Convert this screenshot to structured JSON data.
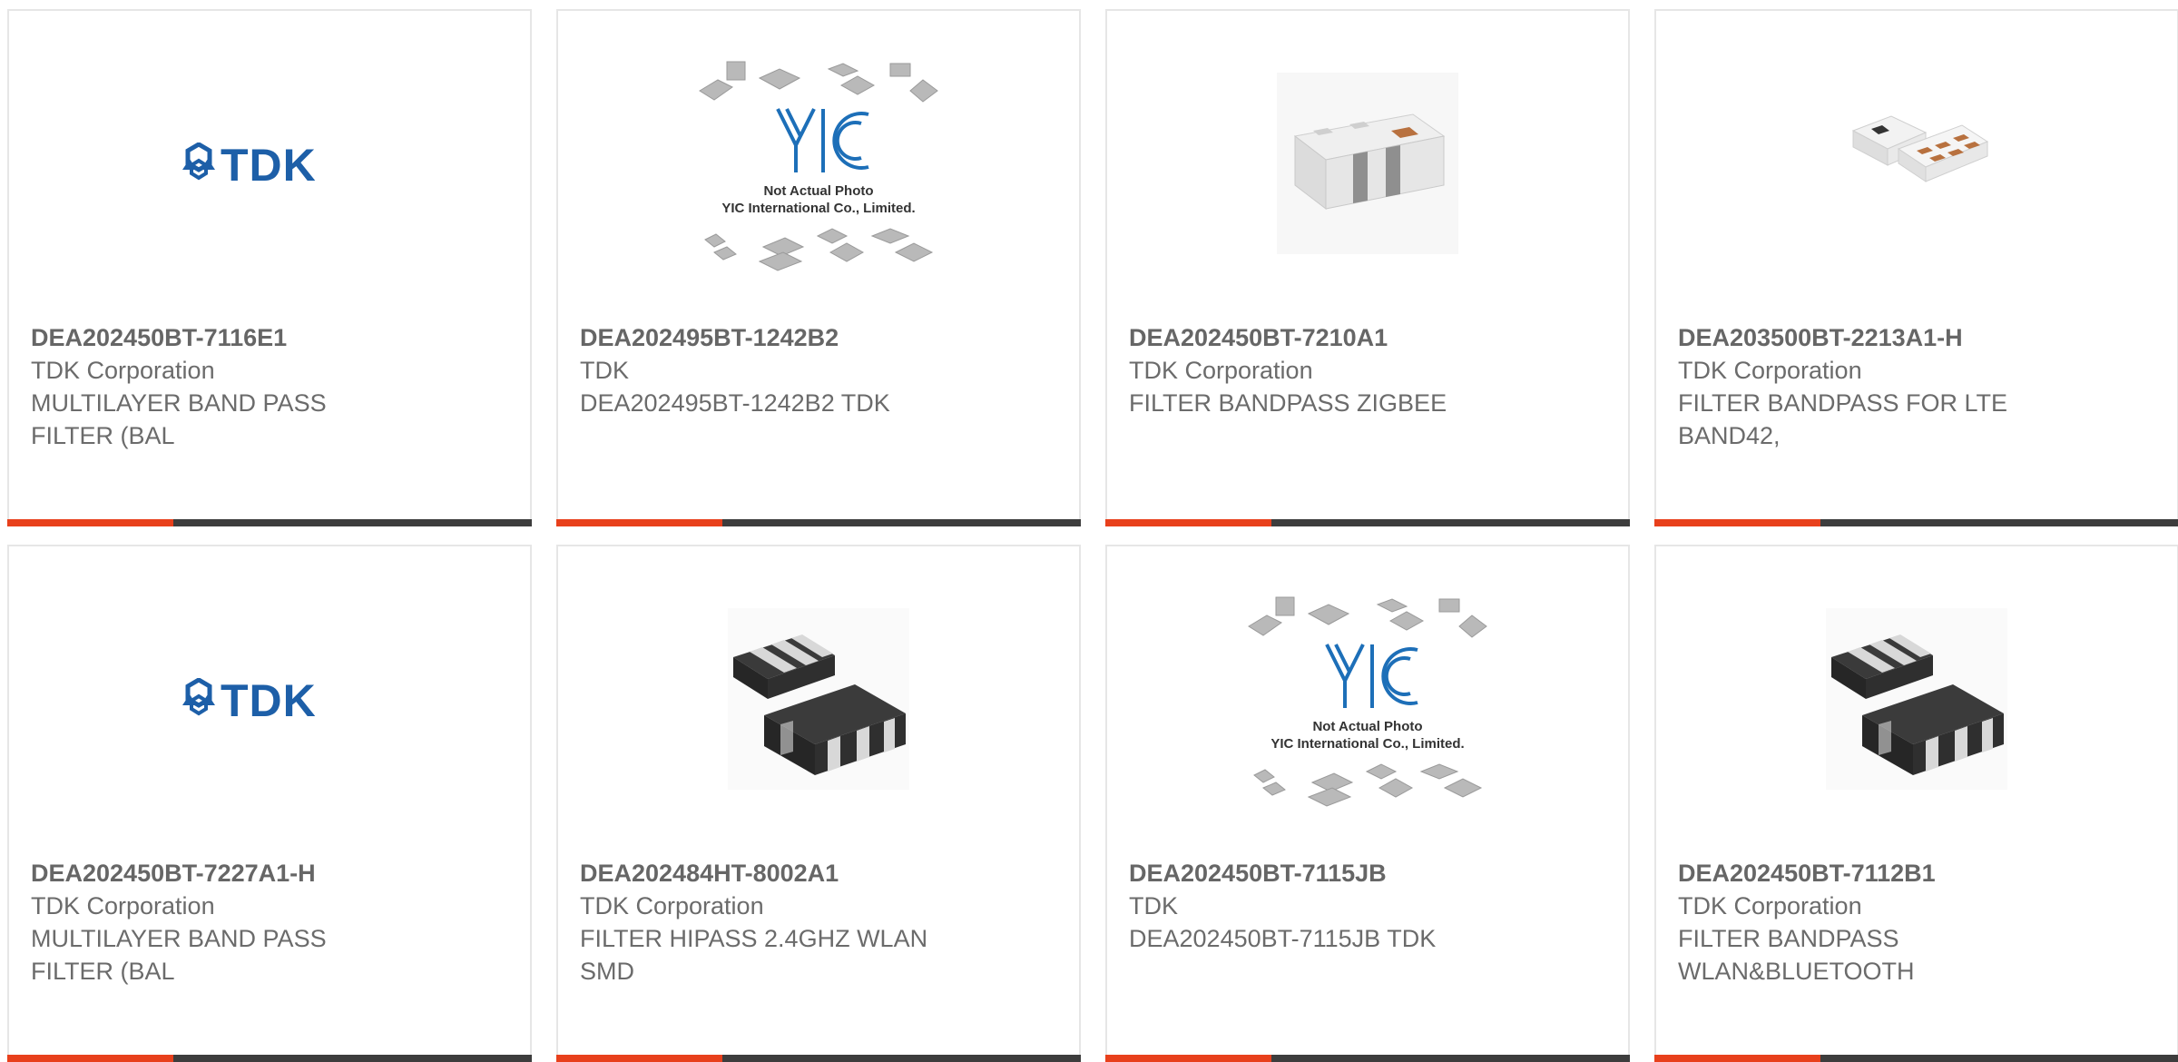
{
  "colors": {
    "accent": "#e8401c",
    "bar": "#3d3d3d",
    "text": "#6b6b6b",
    "border": "#e6e6e6",
    "tdk_blue": "#1d5fa8"
  },
  "products": [
    {
      "part_number": "DEA202450BT-7116E1",
      "manufacturer": "TDK Corporation",
      "description": "MULTILAYER BAND PASS FILTER (BAL",
      "image": "tdk-logo",
      "logo_text": "TDK"
    },
    {
      "part_number": "DEA202495BT-1242B2",
      "manufacturer": "TDK",
      "description": "DEA202495BT-1242B2 TDK",
      "image": "yic-placeholder",
      "logo_text": "YIC",
      "caption_line1": "Not Actual Photo",
      "caption_line2": "YIC International Co., Limited."
    },
    {
      "part_number": "DEA202450BT-7210A1",
      "manufacturer": "TDK Corporation",
      "description": "FILTER BANDPASS ZIGBEE",
      "image": "white-chip-photo"
    },
    {
      "part_number": "DEA203500BT-2213A1-H",
      "manufacturer": "TDK Corporation",
      "description": "FILTER BANDPASS FOR LTE BAND42,",
      "image": "white-chip-pads-photo"
    },
    {
      "part_number": "DEA202450BT-7227A1-H",
      "manufacturer": "TDK Corporation",
      "description": "MULTILAYER BAND PASS FILTER (BAL",
      "image": "tdk-logo",
      "logo_text": "TDK"
    },
    {
      "part_number": "DEA202484HT-8002A1",
      "manufacturer": "TDK Corporation",
      "description": "FILTER HIPASS 2.4GHZ WLAN SMD",
      "image": "black-chip-photo"
    },
    {
      "part_number": "DEA202450BT-7115JB",
      "manufacturer": "TDK",
      "description": "DEA202450BT-7115JB TDK",
      "image": "yic-placeholder",
      "logo_text": "YIC",
      "caption_line1": "Not Actual Photo",
      "caption_line2": "YIC International Co., Limited."
    },
    {
      "part_number": "DEA202450BT-7112B1",
      "manufacturer": "TDK Corporation",
      "description": "FILTER BANDPASS WLAN&BLUETOOTH",
      "image": "black-chip-photo"
    }
  ]
}
